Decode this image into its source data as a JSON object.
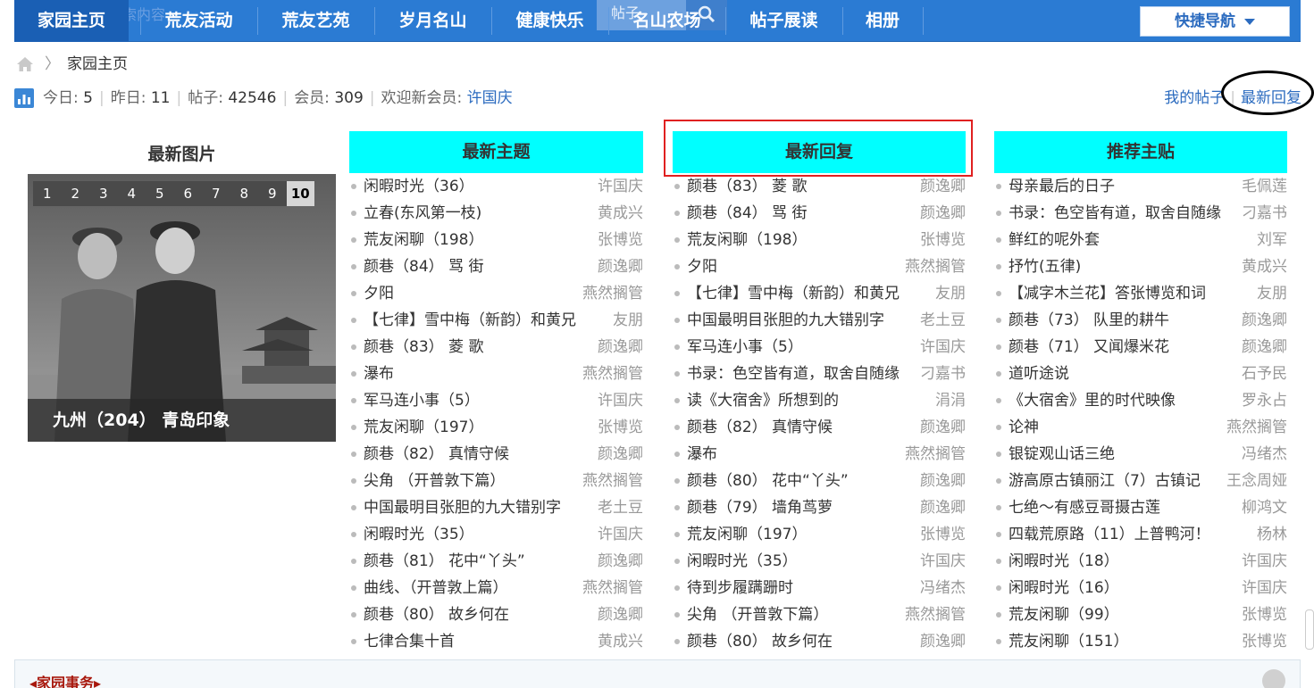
{
  "nav": {
    "items": [
      "家园主页",
      "荒友活动",
      "荒友艺苑",
      "岁月名山",
      "健康快乐",
      "名山农场",
      "帖子展读",
      "相册"
    ],
    "ghost_text": "搜索内容",
    "ghost_search_label": "帖子",
    "quick_nav": "快捷导航"
  },
  "breadcrumb": {
    "current": "家园主页"
  },
  "stats": {
    "today_label": "今日:",
    "today": "5",
    "yesterday_label": "昨日:",
    "yesterday": "11",
    "posts_label": "帖子:",
    "posts": "42546",
    "members_label": "会员:",
    "members": "309",
    "welcome_label": "欢迎新会员:",
    "new_member": "许国庆"
  },
  "top_links": {
    "my_posts": "我的帖子",
    "latest_replies": "最新回复"
  },
  "photo": {
    "title": "最新图片",
    "pages": [
      "1",
      "2",
      "3",
      "4",
      "5",
      "6",
      "7",
      "8",
      "9",
      "10"
    ],
    "current_page": "10",
    "caption": "九州（204） 青岛印象"
  },
  "columns": [
    {
      "title": "最新主题",
      "items": [
        {
          "t": "闲暇时光（36）",
          "a": "许国庆"
        },
        {
          "t": "立春(东风第一枝)",
          "a": "黄成兴"
        },
        {
          "t": "荒友闲聊（198）",
          "a": "张博览"
        },
        {
          "t": "颜巷（84） 骂 街",
          "a": "颜逸卿"
        },
        {
          "t": "夕阳",
          "a": "燕然搁管"
        },
        {
          "t": "【七律】雪中梅（新韵）和黄兄",
          "a": "友朋"
        },
        {
          "t": "颜巷（83） 菱 歌",
          "a": "颜逸卿"
        },
        {
          "t": "瀑布",
          "a": "燕然搁管"
        },
        {
          "t": "军马连小事（5）",
          "a": "许国庆"
        },
        {
          "t": "荒友闲聊（197）",
          "a": "张博览"
        },
        {
          "t": "颜巷（82） 真情守候",
          "a": "颜逸卿"
        },
        {
          "t": "尖角 （开普敦下篇）",
          "a": "燕然搁管"
        },
        {
          "t": "中国最明目张胆的九大错别字",
          "a": "老土豆"
        },
        {
          "t": "闲暇时光（35）",
          "a": "许国庆"
        },
        {
          "t": "颜巷（81） 花中“丫头”",
          "a": "颜逸卿"
        },
        {
          "t": "曲线、（开普敦上篇）",
          "a": "燕然搁管"
        },
        {
          "t": "颜巷（80） 故乡何在",
          "a": "颜逸卿"
        },
        {
          "t": "七律合集十首",
          "a": "黄成兴"
        }
      ]
    },
    {
      "title": "最新回复",
      "items": [
        {
          "t": "颜巷（83） 菱 歌",
          "a": "颜逸卿"
        },
        {
          "t": "颜巷（84） 骂 街",
          "a": "颜逸卿"
        },
        {
          "t": "荒友闲聊（198）",
          "a": "张博览"
        },
        {
          "t": "夕阳",
          "a": "燕然搁管"
        },
        {
          "t": "【七律】雪中梅（新韵）和黄兄",
          "a": "友朋"
        },
        {
          "t": "中国最明目张胆的九大错别字",
          "a": "老土豆"
        },
        {
          "t": "军马连小事（5）",
          "a": "许国庆"
        },
        {
          "t": "书录：色空皆有道，取舍自随缘",
          "a": "刁嘉书"
        },
        {
          "t": "读《大宿舍》所想到的",
          "a": "涓涓"
        },
        {
          "t": "颜巷（82） 真情守候",
          "a": "颜逸卿"
        },
        {
          "t": "瀑布",
          "a": "燕然搁管"
        },
        {
          "t": "颜巷（80） 花中“丫头”",
          "a": "颜逸卿"
        },
        {
          "t": "颜巷（79） 墙角茑萝",
          "a": "颜逸卿"
        },
        {
          "t": "荒友闲聊（197）",
          "a": "张博览"
        },
        {
          "t": "闲暇时光（35）",
          "a": "许国庆"
        },
        {
          "t": "待到步履蹒跚时",
          "a": "冯绪杰"
        },
        {
          "t": "尖角 （开普敦下篇）",
          "a": "燕然搁管"
        },
        {
          "t": "颜巷（80） 故乡何在",
          "a": "颜逸卿"
        }
      ]
    },
    {
      "title": "推荐主贴",
      "items": [
        {
          "t": "母亲最后的日子",
          "a": "毛佩莲"
        },
        {
          "t": "书录：色空皆有道，取舍自随缘",
          "a": "刁嘉书"
        },
        {
          "t": "鲜红的呢外套",
          "a": "刘军"
        },
        {
          "t": "抒竹(五律)",
          "a": "黄成兴"
        },
        {
          "t": "【减字木兰花】答张博览和词",
          "a": "友朋"
        },
        {
          "t": "颜巷（73） 队里的耕牛",
          "a": "颜逸卿"
        },
        {
          "t": "颜巷（71） 又闻爆米花",
          "a": "颜逸卿"
        },
        {
          "t": "道听途说",
          "a": "石予民"
        },
        {
          "t": "《大宿舍》里的时代映像",
          "a": "罗永占"
        },
        {
          "t": "论神",
          "a": "燕然搁管"
        },
        {
          "t": "银锭观山话三绝",
          "a": "冯绪杰"
        },
        {
          "t": "游高原古镇丽江（7）古镇记",
          "a": "王念周娅"
        },
        {
          "t": "七绝～有感豆哥摄古莲",
          "a": "柳鸿文"
        },
        {
          "t": "四载荒原路（11）上普鸭河！",
          "a": "杨林"
        },
        {
          "t": "闲暇时光（18）",
          "a": "许国庆"
        },
        {
          "t": "闲暇时光（16）",
          "a": "许国庆"
        },
        {
          "t": "荒友闲聊（99）",
          "a": "张博览"
        },
        {
          "t": "荒友闲聊（151）",
          "a": "张博览"
        }
      ]
    }
  ],
  "bottom": {
    "title": "家园事务"
  },
  "colors": {
    "nav_bg": "#2b7bd3",
    "column_head": "#00ffff",
    "link": "#2b6bbf",
    "annotation_box": "#e02020"
  },
  "icons": [
    "home-icon",
    "chart-icon",
    "search-icon",
    "chevron-down-icon",
    "collapse-icon"
  ]
}
